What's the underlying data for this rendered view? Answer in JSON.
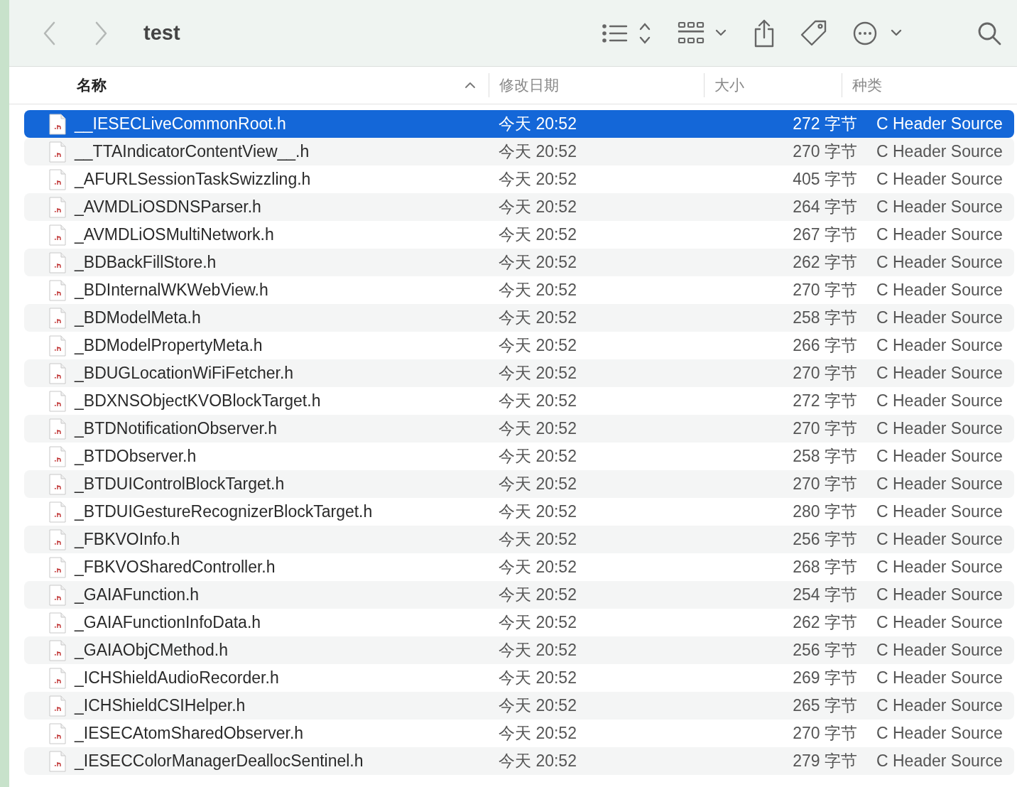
{
  "toolbar": {
    "title": "test"
  },
  "columns": [
    {
      "label": "名称",
      "sorted": true
    },
    {
      "label": "修改日期",
      "sorted": false
    },
    {
      "label": "大小",
      "sorted": false
    },
    {
      "label": "种类",
      "sorted": false
    }
  ],
  "rows": [
    {
      "name": "__IESECLiveCommonRoot.h",
      "date": "今天 20:52",
      "size": "272 字节",
      "kind": "C Header Source",
      "selected": true
    },
    {
      "name": "__TTAIndicatorContentView__.h",
      "date": "今天 20:52",
      "size": "270 字节",
      "kind": "C Header Source",
      "selected": false
    },
    {
      "name": "_AFURLSessionTaskSwizzling.h",
      "date": "今天 20:52",
      "size": "405 字节",
      "kind": "C Header Source",
      "selected": false
    },
    {
      "name": "_AVMDLiOSDNSParser.h",
      "date": "今天 20:52",
      "size": "264 字节",
      "kind": "C Header Source",
      "selected": false
    },
    {
      "name": "_AVMDLiOSMultiNetwork.h",
      "date": "今天 20:52",
      "size": "267 字节",
      "kind": "C Header Source",
      "selected": false
    },
    {
      "name": "_BDBackFillStore.h",
      "date": "今天 20:52",
      "size": "262 字节",
      "kind": "C Header Source",
      "selected": false
    },
    {
      "name": "_BDInternalWKWebView.h",
      "date": "今天 20:52",
      "size": "270 字节",
      "kind": "C Header Source",
      "selected": false
    },
    {
      "name": "_BDModelMeta.h",
      "date": "今天 20:52",
      "size": "258 字节",
      "kind": "C Header Source",
      "selected": false
    },
    {
      "name": "_BDModelPropertyMeta.h",
      "date": "今天 20:52",
      "size": "266 字节",
      "kind": "C Header Source",
      "selected": false
    },
    {
      "name": "_BDUGLocationWiFiFetcher.h",
      "date": "今天 20:52",
      "size": "270 字节",
      "kind": "C Header Source",
      "selected": false
    },
    {
      "name": "_BDXNSObjectKVOBlockTarget.h",
      "date": "今天 20:52",
      "size": "272 字节",
      "kind": "C Header Source",
      "selected": false
    },
    {
      "name": "_BTDNotificationObserver.h",
      "date": "今天 20:52",
      "size": "270 字节",
      "kind": "C Header Source",
      "selected": false
    },
    {
      "name": "_BTDObserver.h",
      "date": "今天 20:52",
      "size": "258 字节",
      "kind": "C Header Source",
      "selected": false
    },
    {
      "name": "_BTDUIControlBlockTarget.h",
      "date": "今天 20:52",
      "size": "270 字节",
      "kind": "C Header Source",
      "selected": false
    },
    {
      "name": "_BTDUIGestureRecognizerBlockTarget.h",
      "date": "今天 20:52",
      "size": "280 字节",
      "kind": "C Header Source",
      "selected": false
    },
    {
      "name": "_FBKVOInfo.h",
      "date": "今天 20:52",
      "size": "256 字节",
      "kind": "C Header Source",
      "selected": false
    },
    {
      "name": "_FBKVOSharedController.h",
      "date": "今天 20:52",
      "size": "268 字节",
      "kind": "C Header Source",
      "selected": false
    },
    {
      "name": "_GAIAFunction.h",
      "date": "今天 20:52",
      "size": "254 字节",
      "kind": "C Header Source",
      "selected": false
    },
    {
      "name": "_GAIAFunctionInfoData.h",
      "date": "今天 20:52",
      "size": "262 字节",
      "kind": "C Header Source",
      "selected": false
    },
    {
      "name": "_GAIAObjCMethod.h",
      "date": "今天 20:52",
      "size": "256 字节",
      "kind": "C Header Source",
      "selected": false
    },
    {
      "name": "_ICHShieldAudioRecorder.h",
      "date": "今天 20:52",
      "size": "269 字节",
      "kind": "C Header Source",
      "selected": false
    },
    {
      "name": "_ICHShieldCSIHelper.h",
      "date": "今天 20:52",
      "size": "265 字节",
      "kind": "C Header Source",
      "selected": false
    },
    {
      "name": "_IESECAtomSharedObserver.h",
      "date": "今天 20:52",
      "size": "270 字节",
      "kind": "C Header Source",
      "selected": false
    },
    {
      "name": "_IESECColorManagerDeallocSentinel.h",
      "date": "今天 20:52",
      "size": "279 字节",
      "kind": "C Header Source",
      "selected": false
    }
  ]
}
